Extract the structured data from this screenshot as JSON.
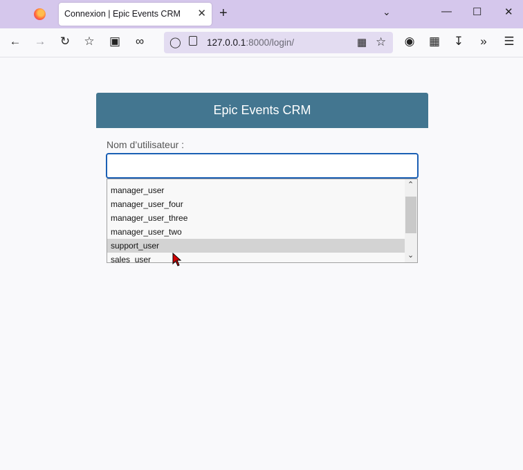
{
  "browser": {
    "tab_title": "Connexion | Epic Events CRM",
    "tab_close": "✕",
    "new_tab": "+",
    "tab_list": "⌄",
    "win_min": "—",
    "win_max": "☐",
    "win_close": "✕",
    "url_host": "127.0.0.1",
    "url_rest": ":8000/login/"
  },
  "page": {
    "title": "Epic Events CRM",
    "username_label": "Nom d’utilisateur :",
    "username_value": ""
  },
  "autocomplete": {
    "items": [
      "manager_user",
      "manager_user_four",
      "manager_user_three",
      "manager_user_two",
      "support_user",
      "sales_user"
    ],
    "selected": "support_user"
  },
  "colors": {
    "header": "#437690",
    "tabbar": "#d5c7ec",
    "input_focus": "#1a5fb4"
  }
}
